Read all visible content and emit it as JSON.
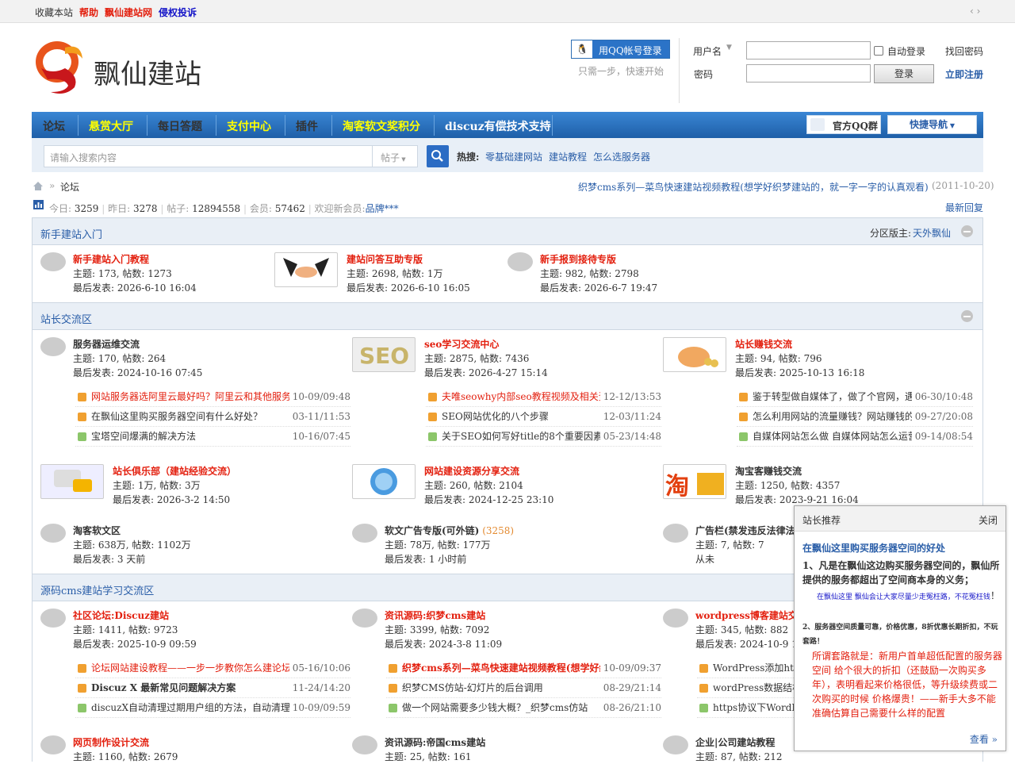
{
  "topbar": {
    "fav": "收藏本站",
    "help": "帮助",
    "site": "飘仙建站网",
    "report": "侵权投诉",
    "arrows": "‹ ›"
  },
  "logo_text": "飘仙建站",
  "login": {
    "qq_button": "用QQ帐号登录",
    "qq_sub": "只需一步，快速开始",
    "username_label": "用户名",
    "password_label": "密码",
    "auto_login": "自动登录",
    "find_password": "找回密码",
    "register": "立即注册",
    "login_button": "登录"
  },
  "nav": {
    "items": [
      {
        "label": "论坛",
        "color": "#ffffff"
      },
      {
        "label": "悬赏大厅",
        "color": "#ffff00"
      },
      {
        "label": "每日答题",
        "color": "#ffffff"
      },
      {
        "label": "支付中心",
        "color": "#ffff00"
      },
      {
        "label": "插件",
        "color": "#ffffff"
      },
      {
        "label": "淘客软文奖积分",
        "color": "#ffff00"
      },
      {
        "label": "discuz有偿技术支持",
        "color": "#ffffff"
      }
    ],
    "qq_group": "官方QQ群",
    "quick_nav": "快捷导航"
  },
  "search": {
    "placeholder": "请输入搜索内容",
    "type": "帖子",
    "hot_label": "热搜:",
    "hot": [
      "零基础建网站",
      "建站教程",
      "怎么选服务器"
    ]
  },
  "breadcrumb": {
    "current": "论坛",
    "notice": "织梦cms系列—菜鸟快速建站视频教程(想学好织梦建站的，就一字一字的认真观看)",
    "notice_date": "(2011-10-20)"
  },
  "stats": {
    "today_label": "今日:",
    "today": "3259",
    "yesterday_label": "昨日:",
    "yesterday": "3278",
    "posts_label": "帖子:",
    "posts": "12894558",
    "members_label": "会员:",
    "members": "57462",
    "welcome": "欢迎新会员:",
    "new_member": "品牌***",
    "latest": "最新回复"
  },
  "sections": {
    "s1": {
      "title": "新手建站入门",
      "mod_label": "分区版主:",
      "mod": "天外飘仙",
      "forums": [
        {
          "name": "新手建站入门教程",
          "stats": "主题: 173, 帖数: 1273",
          "last": "最后发表: 2026-6-10 16:04"
        },
        {
          "name": "建站问答互助专版",
          "stats": "主题: 2698, 帖数: 1万",
          "last": "最后发表: 2026-6-10 16:05"
        },
        {
          "name": "新手报到接待专版",
          "stats": "主题: 982, 帖数: 2798",
          "last": "最后发表: 2026-6-7 19:47"
        }
      ]
    },
    "s2": {
      "title": "站长交流区",
      "forums": [
        {
          "name": "服务器运维交流",
          "stats": "主题: 170, 帖数: 264",
          "last": "最后发表: 2024-10-16 07:45",
          "threads": [
            {
              "title": "网站服务器选阿里云最好吗？阿里云和其他服务商",
              "time": "10-09/09:48",
              "red": true
            },
            {
              "title": "在飘仙这里购买服务器空间有什么好处？",
              "time": "03-11/11:53",
              "red": false
            },
            {
              "title": "宝塔空间爆满的解决方法",
              "time": "10-16/07:45",
              "red": false
            }
          ]
        },
        {
          "name": "seo学习交流中心",
          "stats": "主题: 2875, 帖数: 7436",
          "last": "最后发表: 2026-4-27 15:14",
          "threads": [
            {
              "title": "夫唯seowhy内部seo教程视频及相关资",
              "time": "12-12/13:53",
              "red": true
            },
            {
              "title": "SEO网站优化的八个步骤",
              "time": "12-03/11:24",
              "red": false
            },
            {
              "title": "关于SEO如何写好title的8个重要因素",
              "time": "05-23/14:48",
              "red": false
            }
          ]
        },
        {
          "name": "站长赚钱交流",
          "stats": "主题: 94, 帖数: 796",
          "last": "最后发表: 2025-10-13 16:18",
          "threads": [
            {
              "title": "鉴于转型做自媒体了，做了个官网，遇",
              "time": "06-30/10:48",
              "red": false
            },
            {
              "title": "怎么利用网站的流量赚钱？网站赚钱的",
              "time": "09-27/20:08",
              "red": false
            },
            {
              "title": "自媒体网站怎么做 自媒体网站怎么运营",
              "time": "09-14/08:54",
              "red": false
            }
          ]
        },
        {
          "name": "站长俱乐部（建站经验交流）",
          "stats": "主题: 1万, 帖数: 3万",
          "last": "最后发表: 2026-3-2 14:50"
        },
        {
          "name": "网站建设资源分享交流",
          "stats": "主题: 260, 帖数: 2104",
          "last": "最后发表: 2024-12-25 23:10"
        },
        {
          "name": "淘宝客赚钱交流",
          "stats": "主题: 1250, 帖数: 4357",
          "last": "最后发表: 2023-9-21 16:04"
        },
        {
          "name": "淘客软文区",
          "stats": "主题: 638万, 帖数: 1102万",
          "last": "最后发表: 3 天前"
        },
        {
          "name": "软文广告专版(可外链)",
          "count": "(3258)",
          "stats": "主题: 78万, 帖数: 177万",
          "last": "最后发表: 1 小时前"
        },
        {
          "name": "广告栏(禁发违反法律法",
          "stats": "主题: 7, 帖数: 7",
          "last": "从未"
        }
      ]
    },
    "s3": {
      "title": "源码cms建站学习交流区",
      "forums": [
        {
          "name": "社区论坛:Discuz建站",
          "stats": "主题: 1411, 帖数: 9723",
          "last": "最后发表: 2025-10-9 09:59",
          "threads": [
            {
              "title": "论坛网站建设教程——一步一步教你怎么建论坛-",
              "time": "05-16/10:06",
              "red": true
            },
            {
              "title": "Discuz X 最新常见问题解决方案",
              "time": "11-24/14:20",
              "red": false,
              "bold": true
            },
            {
              "title": "discuzX自动清理过期用户组的方法，自动清理vip",
              "time": "10-09/09:59",
              "red": false
            }
          ]
        },
        {
          "name": "资讯源码:织梦cms建站",
          "stats": "主题: 3399, 帖数: 7092",
          "last": "最后发表: 2024-3-8 11:09",
          "threads": [
            {
              "title": "织梦cms系列—菜鸟快速建站视频教程(想学好织梦",
              "time": "10-09/09:37",
              "red": true,
              "bold": true
            },
            {
              "title": "织梦CMS仿站-幻灯片的后台调用",
              "time": "08-29/21:14",
              "red": false
            },
            {
              "title": "做一个网站需要多少钱大概？_织梦cms仿站",
              "time": "08-26/21:10",
              "red": false
            }
          ]
        },
        {
          "name": "wordpress博客建站交流",
          "stats": "主题: 345, 帖数: 882",
          "last": "最后发表: 2024-10-9 16:",
          "threads": [
            {
              "title": "WordPress添加https",
              "time": "",
              "red": false
            },
            {
              "title": "wordPress数据结构",
              "time": "",
              "red": false
            },
            {
              "title": "https协议下WordPre",
              "time": "",
              "red": false
            }
          ]
        },
        {
          "name": "网页制作设计交流",
          "stats": "主题: 1160, 帖数: 2679"
        },
        {
          "name": "资讯源码:帝国cms建站",
          "stats": "主题: 25, 帖数: 161"
        },
        {
          "name": "企业|公司建站教程",
          "stats": "主题: 87, 帖数: 212"
        }
      ]
    }
  },
  "popup": {
    "title": "站长推荐",
    "close": "关闭",
    "headline": "在飘仙这里购买服务器空间的好处",
    "p1": "1、凡是在飘仙这边购买服务器空间的，飘仙所提供的服务都超出了空间商本身的义务；",
    "p2": "在飘仙这里 飘仙会让大家尽量少走冤枉路，不花冤枉钱",
    "p2b": "！",
    "p3": "2、服务器空间质量可靠，价格优惠，8折优惠长期折扣，不玩套路！",
    "p4": "所谓套路就是：新用户首单超低配置的服务器空间 给个很大的折扣（还鼓励一次购买多年），表明看起来价格很低，等升级续费或二次购买的时候 价格爆贵！——新手大多不能准确估算自己需要什么样的配置",
    "more": "查看 »"
  }
}
